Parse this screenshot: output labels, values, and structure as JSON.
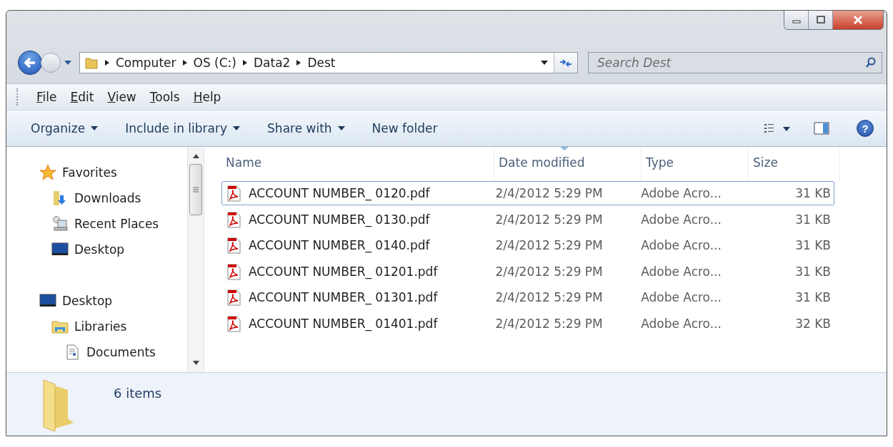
{
  "address_bar": {
    "path": [
      "Computer",
      "OS (C:)",
      "Data2",
      "Dest"
    ]
  },
  "search": {
    "placeholder": "Search Dest"
  },
  "menu_bar": [
    "File",
    "Edit",
    "View",
    "Tools",
    "Help"
  ],
  "command_bar": [
    {
      "label": "Organize",
      "dropdown": true
    },
    {
      "label": "Include in library",
      "dropdown": true
    },
    {
      "label": "Share with",
      "dropdown": true
    },
    {
      "label": "New folder",
      "dropdown": false
    }
  ],
  "navigation_pane": [
    {
      "label": "Favorites",
      "kind": "star",
      "children": [
        {
          "label": "Downloads",
          "kind": "downloads"
        },
        {
          "label": "Recent Places",
          "kind": "recent"
        },
        {
          "label": "Desktop",
          "kind": "desktop"
        }
      ]
    },
    {
      "label": "Desktop",
      "kind": "desktop",
      "children": [
        {
          "label": "Libraries",
          "kind": "libraries",
          "children": [
            {
              "label": "Documents",
              "kind": "document"
            }
          ]
        }
      ]
    }
  ],
  "table": {
    "columns": [
      {
        "label": "Name",
        "sorted": false
      },
      {
        "label": "Date modified",
        "sorted": true
      },
      {
        "label": "Type",
        "sorted": false
      },
      {
        "label": "Size",
        "sorted": false
      }
    ],
    "rows": [
      {
        "name": "ACCOUNT NUMBER_ 0120.pdf",
        "date": "2/4/2012 5:29 PM",
        "type": "Adobe Acro...",
        "size": "31 KB",
        "selected": true
      },
      {
        "name": "ACCOUNT NUMBER_ 0130.pdf",
        "date": "2/4/2012 5:29 PM",
        "type": "Adobe Acro...",
        "size": "31 KB",
        "selected": false
      },
      {
        "name": "ACCOUNT NUMBER_ 0140.pdf",
        "date": "2/4/2012 5:29 PM",
        "type": "Adobe Acro...",
        "size": "31 KB",
        "selected": false
      },
      {
        "name": "ACCOUNT NUMBER_ 01201.pdf",
        "date": "2/4/2012 5:29 PM",
        "type": "Adobe Acro...",
        "size": "31 KB",
        "selected": false
      },
      {
        "name": "ACCOUNT NUMBER_ 01301.pdf",
        "date": "2/4/2012 5:29 PM",
        "type": "Adobe Acro...",
        "size": "31 KB",
        "selected": false
      },
      {
        "name": "ACCOUNT NUMBER_ 01401.pdf",
        "date": "2/4/2012 5:29 PM",
        "type": "Adobe Acro...",
        "size": "32 KB",
        "selected": false
      }
    ]
  },
  "help_button": {
    "label": "?"
  },
  "status_bar": {
    "item_count": "6 items"
  }
}
